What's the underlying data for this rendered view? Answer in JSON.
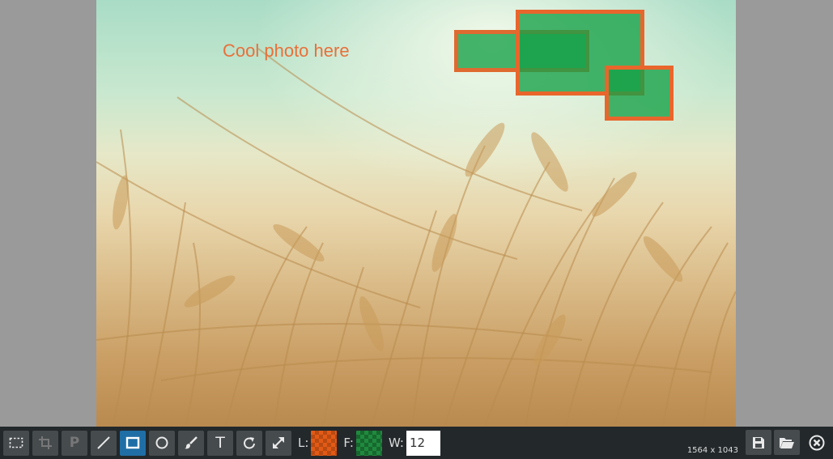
{
  "canvas": {
    "text": "Cool photo here",
    "shape_fill": "#14a046",
    "shape_stroke": "#e8662c"
  },
  "toolbar": {
    "tools": [
      {
        "name": "select",
        "icon": "select-icon",
        "state": "normal"
      },
      {
        "name": "crop",
        "icon": "crop-icon",
        "state": "disabled"
      },
      {
        "name": "pixelate",
        "icon": "pixelate-icon",
        "label": "P",
        "state": "disabled"
      },
      {
        "name": "line",
        "icon": "line-icon",
        "state": "normal"
      },
      {
        "name": "rectangle",
        "icon": "rectangle-icon",
        "state": "active"
      },
      {
        "name": "ellipse",
        "icon": "ellipse-icon",
        "state": "normal"
      },
      {
        "name": "brush",
        "icon": "brush-icon",
        "state": "normal"
      },
      {
        "name": "text",
        "icon": "text-icon",
        "label": "T",
        "state": "normal"
      },
      {
        "name": "rotate",
        "icon": "rotate-icon",
        "state": "normal"
      },
      {
        "name": "resize",
        "icon": "resize-icon",
        "state": "normal"
      }
    ],
    "line_label": "L:",
    "line_color": "#e25a16",
    "fill_label": "F:",
    "fill_color": "#1f8a3e",
    "width_label": "W:",
    "width_value": "12",
    "image_size": "1564 x 1043",
    "save_icon": "save-icon",
    "open_icon": "folder-open-icon",
    "close_icon": "close-icon"
  }
}
